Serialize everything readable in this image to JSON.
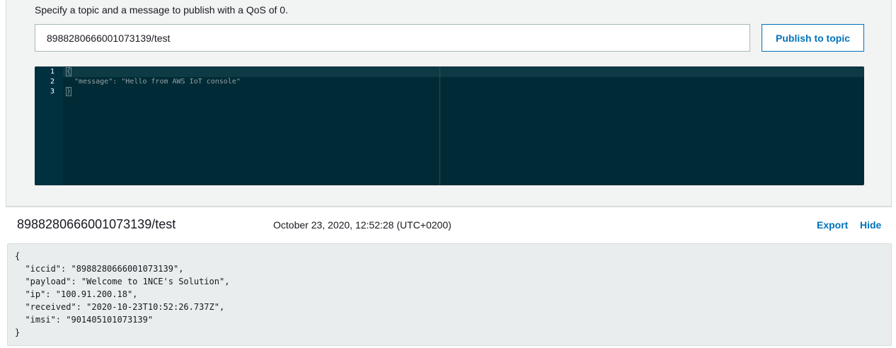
{
  "publish": {
    "hint": "Specify a topic and a message to publish with a QoS of 0.",
    "topic_value": "8988280666001073139/test",
    "button_label": "Publish to topic"
  },
  "editor": {
    "line_numbers": [
      "1",
      "2",
      "3"
    ],
    "lines": [
      "{",
      "  \"message\": \"Hello from AWS IoT console\"",
      "}"
    ]
  },
  "message": {
    "topic": "8988280666001073139/test",
    "timestamp": "October 23, 2020, 12:52:28 (UTC+0200)",
    "export_label": "Export",
    "hide_label": "Hide",
    "payload_lines": [
      "{",
      "  \"iccid\": \"8988280666001073139\",",
      "  \"payload\": \"Welcome to 1NCE's Solution\",",
      "  \"ip\": \"100.91.200.18\",",
      "  \"received\": \"2020-10-23T10:52:26.737Z\",",
      "  \"imsi\": \"901405101073139\"",
      "}"
    ]
  },
  "colors": {
    "accent": "#0073bb",
    "editor_bg": "#002b36",
    "panel_bg": "#f2f3f3",
    "payload_bg": "#eaeded"
  }
}
